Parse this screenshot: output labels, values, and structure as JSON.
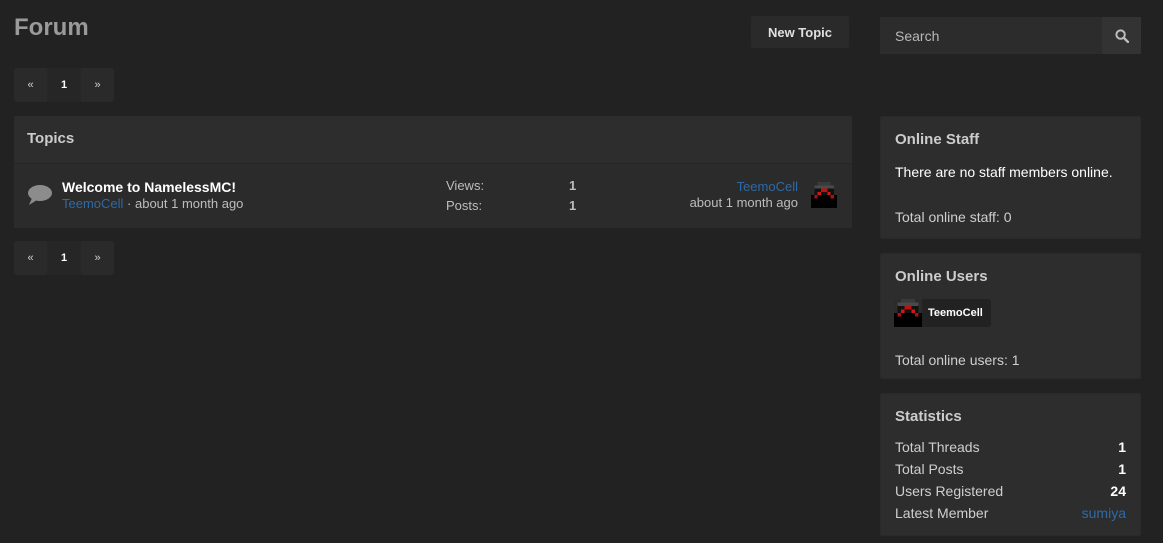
{
  "page": {
    "title": "Forum"
  },
  "toolbar": {
    "new_topic_label": "New Topic"
  },
  "search": {
    "placeholder": "Search"
  },
  "pagination": {
    "prev": "«",
    "current": "1",
    "next": "»"
  },
  "topics": {
    "heading": "Topics",
    "items": [
      {
        "title": "Welcome to NamelessMC!",
        "author": "TeemoCell",
        "posted": "· about 1 month ago",
        "views_label": "Views:",
        "views": "1",
        "posts_label": "Posts:",
        "posts": "1",
        "last_poster": "TeemoCell",
        "last_time": "about 1 month ago"
      }
    ]
  },
  "online_staff": {
    "title": "Online Staff",
    "message": "There are no staff members online.",
    "total": "Total online staff: 0"
  },
  "online_users": {
    "title": "Online Users",
    "users": [
      "TeemoCell"
    ],
    "total": "Total online users: 1"
  },
  "statistics": {
    "title": "Statistics",
    "rows": [
      {
        "label": "Total Threads",
        "value": "1"
      },
      {
        "label": "Total Posts",
        "value": "1"
      },
      {
        "label": "Users Registered",
        "value": "24"
      },
      {
        "label": "Latest Member",
        "value": "sumiya"
      }
    ]
  },
  "colors": {
    "background": "#222222",
    "panel": "#2d2d2d",
    "link": "#2e6aa6"
  },
  "icons": {
    "search": "search-icon",
    "topic": "speech-bubble-icon",
    "avatar": "minecraft-avatar-icon"
  }
}
